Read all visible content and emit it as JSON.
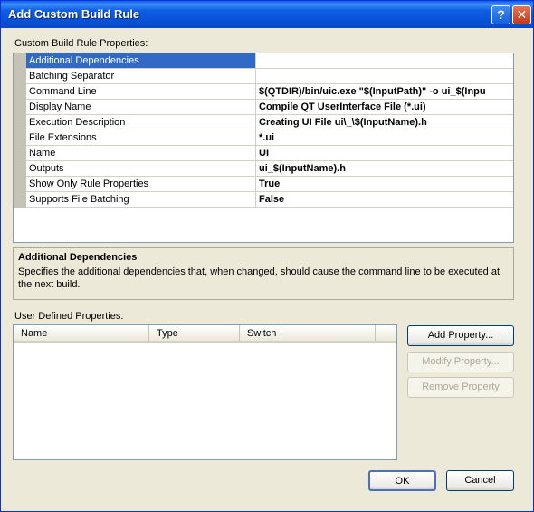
{
  "window": {
    "title": "Add Custom Build Rule"
  },
  "properties_label": "Custom Build Rule Properties:",
  "properties": [
    {
      "name": "Additional Dependencies",
      "value": ""
    },
    {
      "name": "Batching Separator",
      "value": ""
    },
    {
      "name": "Command Line",
      "value": "$(QTDIR)/bin/uic.exe \"$(InputPath)\" -o ui_$(Inpu"
    },
    {
      "name": "Display Name",
      "value": "Compile QT UserInterface File (*.ui)"
    },
    {
      "name": "Execution Description",
      "value": "Creating UI File ui\\_\\$(InputName).h"
    },
    {
      "name": "File Extensions",
      "value": "*.ui"
    },
    {
      "name": "Name",
      "value": "UI"
    },
    {
      "name": "Outputs",
      "value": "ui_$(InputName).h"
    },
    {
      "name": "Show Only Rule Properties",
      "value": "True"
    },
    {
      "name": "Supports File Batching",
      "value": "False"
    }
  ],
  "selected_property_index": 0,
  "description": {
    "title": "Additional Dependencies",
    "text": "Specifies the additional dependencies that, when changed, should cause the command line to be executed at the next build."
  },
  "user_props_label": "User Defined Properties:",
  "columns": [
    "Name",
    "Type",
    "Switch"
  ],
  "buttons": {
    "add": "Add Property...",
    "modify": "Modify Property...",
    "remove": "Remove Property",
    "ok": "OK",
    "cancel": "Cancel"
  },
  "titlebar_icons": [
    "help-icon",
    "close-icon"
  ]
}
